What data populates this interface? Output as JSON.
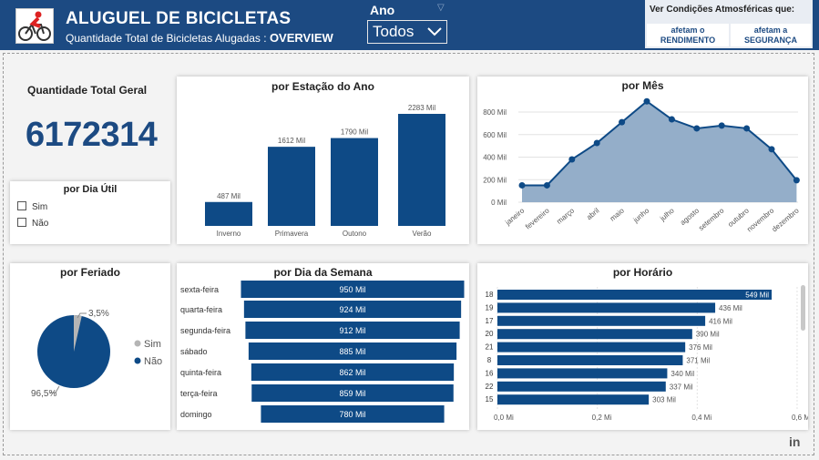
{
  "header": {
    "title": "ALUGUEL DE BICICLETAS",
    "subtitle_prefix": "Quantidade Total de Bicicletas Alugadas :",
    "subtitle_strong": "OVERVIEW",
    "logo_icon": "cyclist-logo-icon"
  },
  "filter": {
    "label": "Ano",
    "selected": "Todos"
  },
  "weather": {
    "title": "Ver Condições Atmosféricas que:",
    "btn1": [
      "afetam o",
      "RENDIMENTO"
    ],
    "btn2": [
      "afetam a",
      "SEGURANÇA"
    ]
  },
  "kpi": {
    "title": "Quantidade Total Geral",
    "value": "6172314"
  },
  "dia_util": {
    "title": "por Dia Útil",
    "options": [
      "Sim",
      "Não"
    ]
  },
  "colors": {
    "primary": "#0e4a86",
    "area_fill": "#94aec9",
    "header": "#1c4a82",
    "pie_gray": "#b5b5b5"
  },
  "chart_data": [
    {
      "type": "bar",
      "title": "por Estação do Ano",
      "categories": [
        "Inverno",
        "Primavera",
        "Outono",
        "Verão"
      ],
      "values": [
        487,
        1612,
        1790,
        2283
      ],
      "labels": [
        "487 Mil",
        "1612 Mil",
        "1790 Mil",
        "2283 Mil"
      ]
    },
    {
      "type": "area",
      "title": "por Mês",
      "categories": [
        "janeiro",
        "fevereiro",
        "março",
        "abril",
        "maio",
        "junho",
        "julho",
        "agosto",
        "setembro",
        "outubro",
        "novembro",
        "dezembro"
      ],
      "values": [
        150,
        150,
        380,
        525,
        710,
        895,
        735,
        655,
        680,
        655,
        470,
        195
      ],
      "yticks": [
        "0 Mil",
        "200 Mil",
        "400 Mil",
        "600 Mil",
        "800 Mil"
      ],
      "ylim": [
        0,
        900
      ]
    },
    {
      "type": "pie",
      "title": "por Feriado",
      "legend": [
        "Sim",
        "Não"
      ],
      "values": [
        3.5,
        96.5
      ],
      "labels": [
        "3,5%",
        "96,5%"
      ]
    },
    {
      "type": "bar",
      "title": "por Dia da Semana",
      "categories": [
        "sexta-feira",
        "quarta-feira",
        "segunda-feira",
        "sábado",
        "quinta-feira",
        "terça-feira",
        "domingo"
      ],
      "values": [
        950,
        924,
        912,
        885,
        862,
        859,
        780
      ],
      "labels": [
        "950 Mil",
        "924 Mil",
        "912 Mil",
        "885 Mil",
        "862 Mil",
        "859 Mil",
        "780 Mil"
      ]
    },
    {
      "type": "bar",
      "title": "por Horário",
      "categories": [
        "18",
        "19",
        "17",
        "20",
        "21",
        "8",
        "16",
        "22",
        "15"
      ],
      "values": [
        549,
        436,
        416,
        390,
        376,
        371,
        340,
        337,
        303
      ],
      "labels": [
        "549 Mil",
        "436 Mil",
        "416 Mil",
        "390 Mil",
        "376 Mil",
        "371 Mil",
        "340 Mil",
        "337 Mil",
        "303 Mil"
      ],
      "xticks": [
        "0,0 Mi",
        "0,2 Mi",
        "0,4 Mi",
        "0,6 Mi"
      ],
      "xlim": [
        0,
        600
      ]
    }
  ]
}
